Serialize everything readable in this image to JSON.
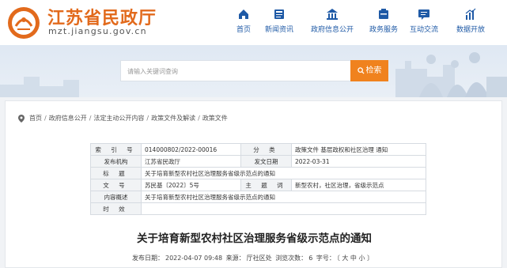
{
  "site": {
    "name": "江苏省民政厅",
    "url": "mzt.jiangsu.gov.cn"
  },
  "nav": [
    {
      "label": "首页",
      "icon": "home-icon"
    },
    {
      "label": "新闻资讯",
      "icon": "news-icon"
    },
    {
      "label": "政府信息公开",
      "icon": "info-disclosure-icon"
    },
    {
      "label": "政务服务",
      "icon": "service-icon"
    },
    {
      "label": "互动交流",
      "icon": "interaction-icon"
    },
    {
      "label": "数据开放",
      "icon": "data-chart-icon"
    }
  ],
  "search": {
    "placeholder": "请输入关键词查询",
    "button_label": "检索"
  },
  "breadcrumb": [
    "首页",
    "政府信息公开",
    "法定主动公开内容",
    "政策文件及解读",
    "政策文件"
  ],
  "meta": {
    "index_label": "索 引 号",
    "index_value": "014000802/2022-00016",
    "category_label": "分 类",
    "category_value": "政策文件 基层政权和社区治理 通知",
    "org_label": "发布机构",
    "org_value": "江苏省民政厅",
    "date_label": "发文日期",
    "date_value": "2022-03-31",
    "title_label": "标 题",
    "title_value": "关于培育新型农村社区治理服务省级示范点的通知",
    "docno_label": "文 号",
    "docno_value": "苏民基〔2022〕5号",
    "keywords_label": "主 题 词",
    "keywords_value": "新型农村，社区治理，省级示范点",
    "summary_label": "内容概述",
    "summary_value": "关于培育新型农村社区治理服务省级示范点的通知",
    "validity_label": "时 效",
    "validity_value": ""
  },
  "article": {
    "title": "关于培育新型农村社区治理服务省级示范点的通知",
    "publish_prefix": "发布日期：",
    "publish_date": "2022-04-07 09:48",
    "source_prefix": "来源：",
    "source": "厅社区处",
    "views_prefix": "浏览次数：",
    "views": "6",
    "fontsize_prefix": "字号：",
    "fontsize_options": "〔 大 中 小 〕"
  },
  "colors": {
    "brand": "#e26a1c",
    "nav": "#1f5aa6",
    "search_button": "#f0821e"
  }
}
